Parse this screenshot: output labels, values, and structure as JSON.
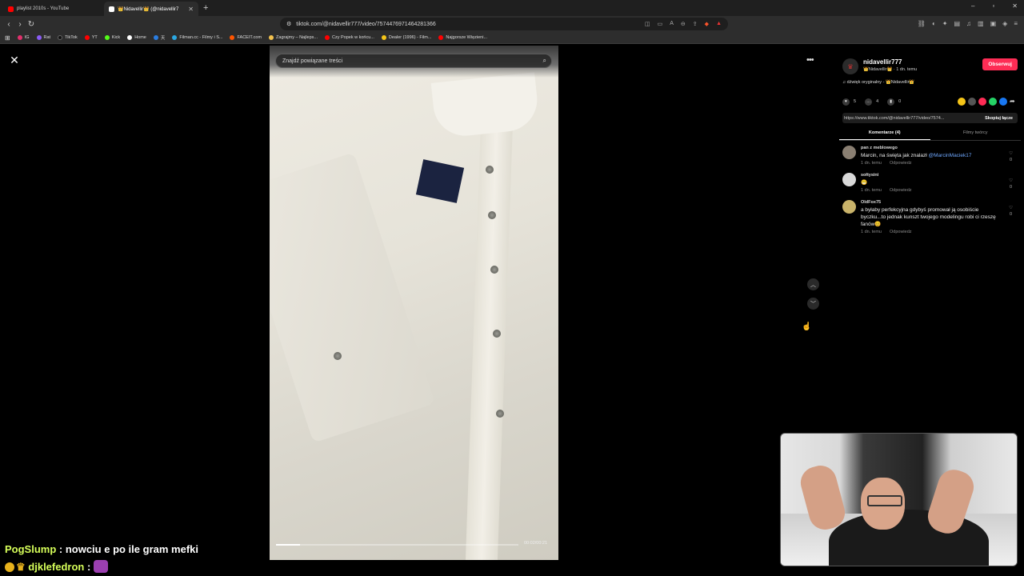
{
  "browser": {
    "tabs": [
      {
        "title": "playlist 2010s - YouTube",
        "active": false,
        "color": "#ff0000"
      },
      {
        "title": "👑Nidavellir👑 (@nidavellir7",
        "active": true,
        "color": "#ffffff"
      }
    ],
    "new_tab": "+",
    "url": "tiktok.com/@nidavellir777/video/7574476971464281366",
    "window_controls": [
      "–",
      "▫",
      "✕"
    ],
    "bookmarks": [
      {
        "label": "IG",
        "color": "#e1306c"
      },
      {
        "label": "Rat",
        "color": "#8a5cf6"
      },
      {
        "label": "TikTok",
        "color": "#111111"
      },
      {
        "label": "YT",
        "color": "#ff0000"
      },
      {
        "label": "Kick",
        "color": "#53fc18"
      },
      {
        "label": "Home",
        "color": "#ffffff"
      },
      {
        "label": "天",
        "color": "#2a7de1"
      },
      {
        "label": "Filman.cc - Filmy i S...",
        "color": "#2aa7e1"
      },
      {
        "label": "FACEIT.com",
        "color": "#ff5500"
      },
      {
        "label": "Zagrajmy – Najleps...",
        "color": "#f2c14e"
      },
      {
        "label": "Czy Popek w końcu...",
        "color": "#ff0000"
      },
      {
        "label": "Dealer (1996) - Film...",
        "color": "#f5c518"
      },
      {
        "label": "Najgorsze Więzieni...",
        "color": "#ff0000"
      }
    ]
  },
  "video": {
    "search_placeholder": "Znajdź powiązane treści",
    "progress": 0.1,
    "time": "00:02/00:21"
  },
  "panel": {
    "username": "nidavellir777",
    "display_name": "👑Nidavellir👑 · 1 dn. temu",
    "follow_label": "Obserwuj",
    "sound": "♫ dźwięk oryginalny - 👑Nidavellir👑",
    "likes": "5",
    "comments_count": "4",
    "saves": "0",
    "link": "https://www.tiktok.com/@nidavellir777/video/7574...",
    "copy_label": "Skopiuj łącze",
    "tab_comments": "Komentarze (4)",
    "tab_videos": "Filmy twórcy",
    "share_colors": [
      "#f5c518",
      "#555555",
      "#fe2c55",
      "#25d366",
      "#1877f2"
    ],
    "comments": [
      {
        "user": "pan z meblowego",
        "text": "Marcin, na święta jak znalazł ",
        "mention": "@MarcinMaciek17",
        "time": "1 dn. temu",
        "reply": "Odpowiedz",
        "likes": "0",
        "avatar": "#8a7f72"
      },
      {
        "user": "sołtysini",
        "text": "😁",
        "mention": "",
        "time": "1 dn. temu",
        "reply": "Odpowiedz",
        "likes": "0",
        "avatar": "#d9d9d9"
      },
      {
        "user": "OldFox75",
        "text": "a byłaby perfekcyjna gdybyś promował ją osobiście byczku...to jednak kunszt twojego modelingu robi ci rzeszę fanów😊",
        "mention": "",
        "time": "1 dn. temu",
        "reply": "Odpowiedz",
        "likes": "0",
        "avatar": "#c9b36a"
      }
    ]
  },
  "chat": {
    "line1_user": "PogSlump",
    "line1_text": " : nowciu e po ile gram mefki",
    "line2_user": "djklefedron",
    "line2_text": " :"
  }
}
